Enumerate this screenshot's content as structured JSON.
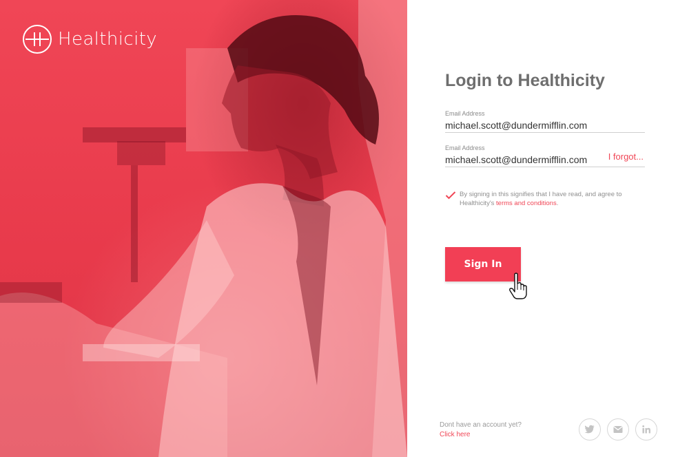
{
  "brand": {
    "name": "Healthicity"
  },
  "login": {
    "title": "Login to Healthicity",
    "email_label": "Email Address",
    "email_value": "michael.scott@dundermifflin.com",
    "second_label": "Email Address",
    "second_value": "michael.scott@dundermifflin.com",
    "forgot_label": "I forgot...",
    "terms_text": "By signing in this signifies that I have read, and agree to Healthicity's",
    "terms_link": "terms and conditions",
    "terms_end": ".",
    "terms_checked": true,
    "signin_label": "Sign In"
  },
  "signup": {
    "question": "Dont have an account yet?",
    "link": "Click here"
  },
  "social": [
    {
      "icon": "twitter-icon"
    },
    {
      "icon": "mail-icon"
    },
    {
      "icon": "linkedin-icon"
    }
  ],
  "colors": {
    "accent": "#f04656",
    "hero": "#e83a4b",
    "text_muted": "#8f8f8f"
  }
}
